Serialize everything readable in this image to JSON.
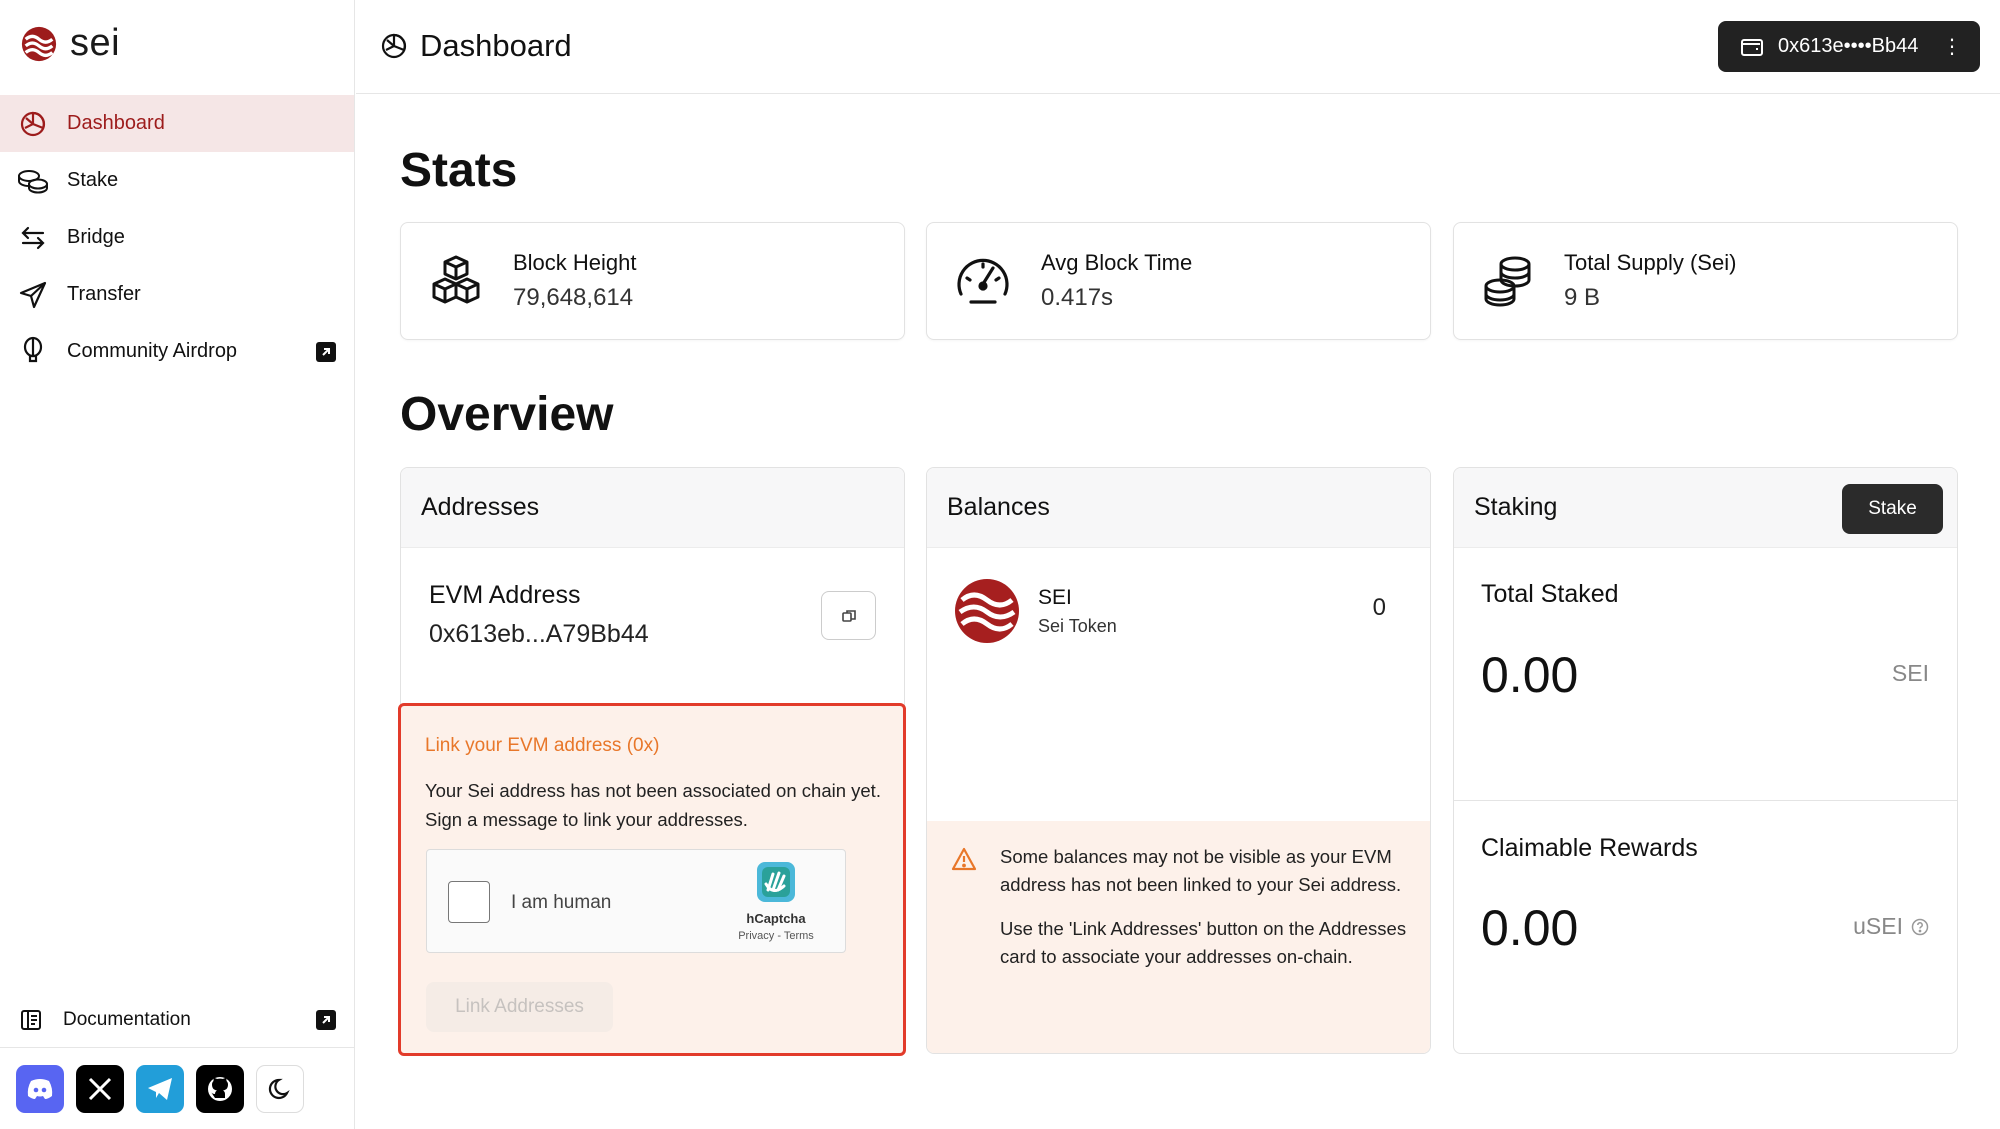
{
  "brand": {
    "name": "sei"
  },
  "sidebar": {
    "items": [
      {
        "label": "Dashboard",
        "icon": "dashboard-icon",
        "active": true
      },
      {
        "label": "Stake",
        "icon": "coins-icon"
      },
      {
        "label": "Bridge",
        "icon": "bridge-arrows-icon"
      },
      {
        "label": "Transfer",
        "icon": "send-icon"
      },
      {
        "label": "Community Airdrop",
        "icon": "balloon-icon",
        "external": true
      }
    ],
    "documentation": "Documentation",
    "social": [
      "discord-icon",
      "x-icon",
      "telegram-icon",
      "github-icon",
      "moon-icon"
    ]
  },
  "header": {
    "title": "Dashboard",
    "wallet": "0x613e••••Bb44"
  },
  "stats": {
    "heading": "Stats",
    "cards": [
      {
        "label": "Block Height",
        "value": "79,648,614",
        "icon": "blocks-icon"
      },
      {
        "label": "Avg Block Time",
        "value": "0.417s",
        "icon": "speedometer-icon"
      },
      {
        "label": "Total Supply (Sei)",
        "value": "9 B",
        "icon": "coin-stack-icon"
      }
    ]
  },
  "overview": {
    "heading": "Overview",
    "addresses": {
      "title": "Addresses",
      "evm_label": "EVM Address",
      "evm_value": "0x613eb...A79Bb44",
      "link_title": "Link your EVM address (0x)",
      "link_desc": "Your Sei address has not been associated on chain yet. Sign a message to link your addresses.",
      "captcha_label": "I am human",
      "captcha_brand": "hCaptcha",
      "captcha_links": "Privacy - Terms",
      "link_button": "Link Addresses"
    },
    "balances": {
      "title": "Balances",
      "token_symbol": "SEI",
      "token_name": "Sei Token",
      "amount": "0",
      "warning_1": "Some balances may not be visible as your EVM address has not been linked to your Sei address.",
      "warning_2": "Use the 'Link Addresses' button on the Addresses card to associate your addresses on-chain."
    },
    "staking": {
      "title": "Staking",
      "stake_button": "Stake",
      "total_staked_label": "Total Staked",
      "total_staked_value": "0.00",
      "total_staked_unit": "SEI",
      "rewards_label": "Claimable Rewards",
      "rewards_value": "0.00",
      "rewards_unit": "uSEI"
    }
  },
  "colors": {
    "accent": "#9d1c1c",
    "warning": "#e8772a",
    "highlight_border": "#e23b2a"
  }
}
